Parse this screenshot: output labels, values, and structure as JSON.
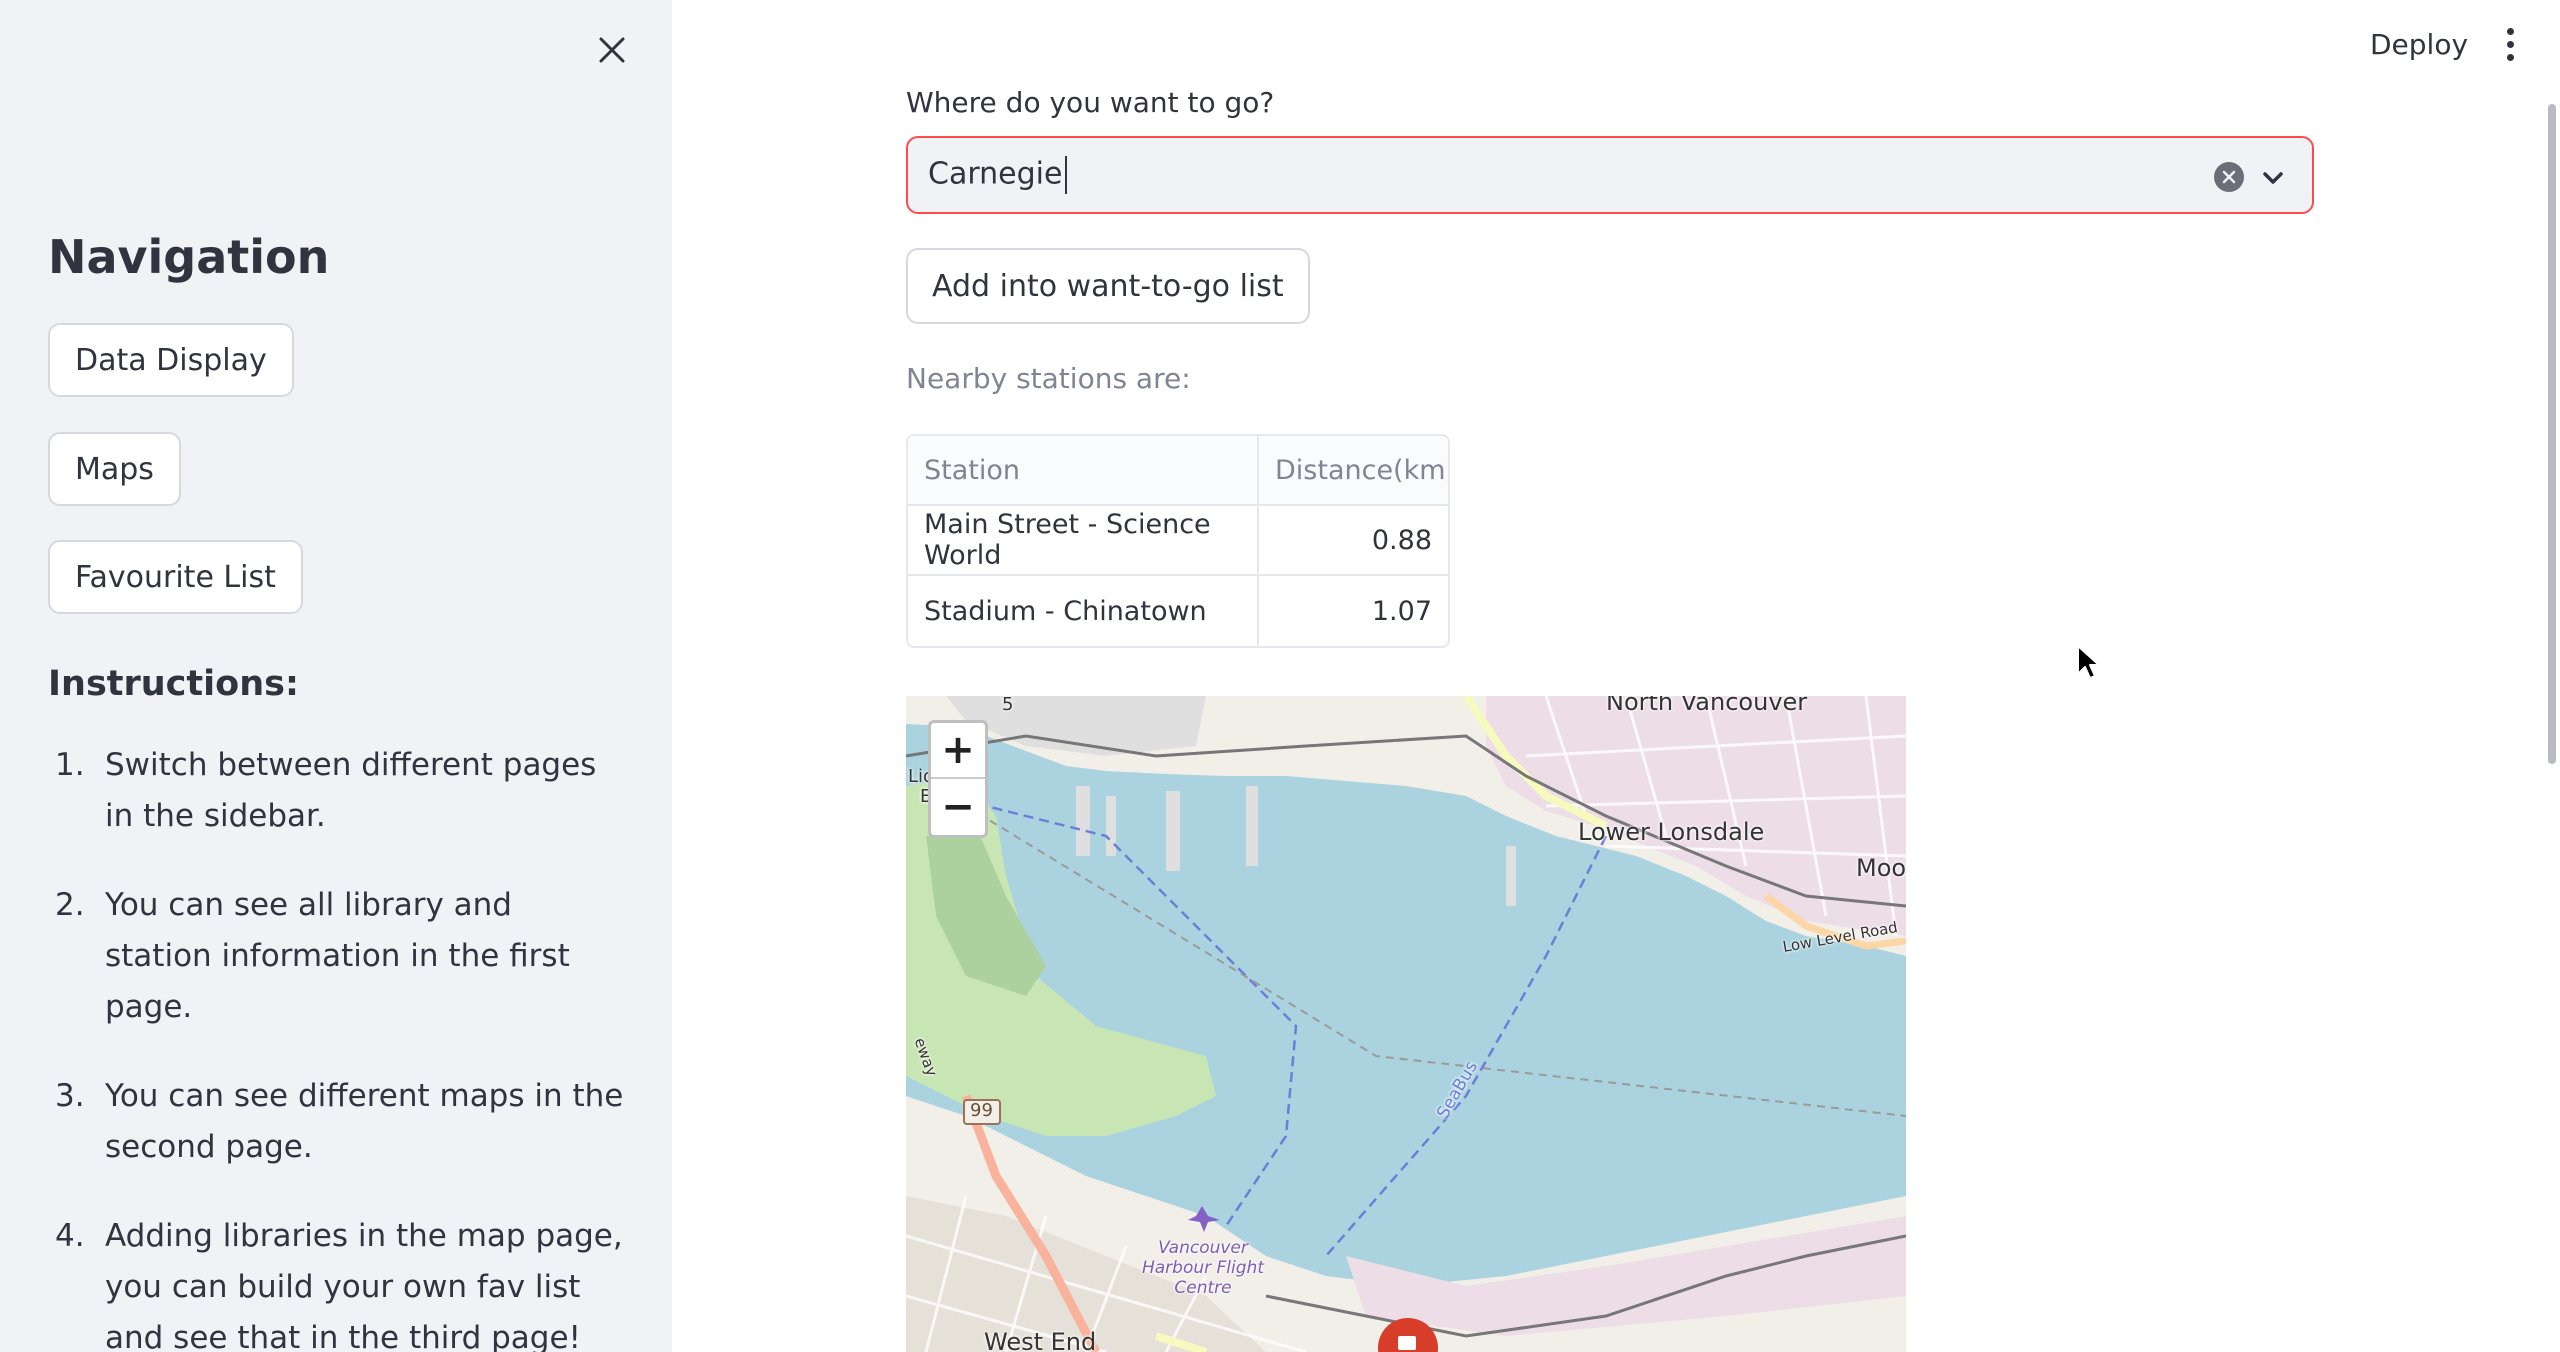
{
  "sidebar": {
    "nav_title": "Navigation",
    "nav_buttons": [
      "Data Display",
      "Maps",
      "Favourite List"
    ],
    "instructions_title": "Instructions:",
    "instructions": [
      {
        "num": "1.",
        "text": "Switch between different pages in the sidebar."
      },
      {
        "num": "2.",
        "text": "You can see all library and station information in the first page."
      },
      {
        "num": "3.",
        "text": "You can see different maps in the second page."
      },
      {
        "num": "4.",
        "text": "Adding libraries in the map page, you can build your own fav list and see that in the third page!"
      }
    ]
  },
  "header": {
    "deploy_label": "Deploy"
  },
  "main": {
    "field_label": "Where do you want to go?",
    "select_value": "Carnegie",
    "add_button": "Add into want-to-go list",
    "nearby_label": "Nearby stations are:",
    "table": {
      "headers": [
        "Station",
        "Distance(km)"
      ],
      "rows": [
        [
          "Main Street - Science World",
          "0.88"
        ],
        [
          "Stadium - Chinatown",
          "1.07"
        ]
      ]
    },
    "map": {
      "zoom_in": "+",
      "zoom_out": "−",
      "labels": {
        "north_vancouver": "North Vancouver",
        "lower_lonsdale": "Lower Lonsdale",
        "moo": "Moo",
        "low_level_road": "Low Level Road",
        "seabus": "SeaBus",
        "highway": "99",
        "harbour": "Vancouver Harbour Flight Centre",
        "west_end": "West End",
        "lio": "Lio",
        "e": "E",
        "eway": "eway",
        "five": "5"
      }
    }
  },
  "colors": {
    "accent": "#ff4b4b",
    "sidebar_bg": "#f0f2f6",
    "water": "#aad3df",
    "park": "#c8e6b4"
  }
}
